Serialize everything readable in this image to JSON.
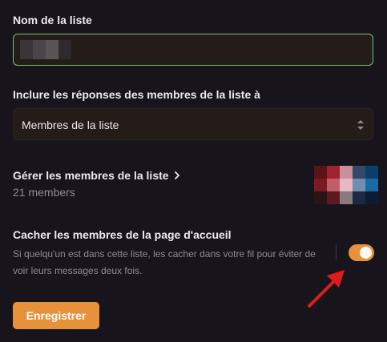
{
  "list_name": {
    "label": "Nom de la liste",
    "value_redacted": true
  },
  "include_replies": {
    "label": "Inclure les réponses des membres de la liste à",
    "selected": "Membres de la liste"
  },
  "manage_members": {
    "label": "Gérer les membres de la liste",
    "count": "21 members"
  },
  "hide_members": {
    "label": "Cacher les membres de la page d'accueil",
    "description_line1": "Si quelqu'un est dans cette liste, les cacher dans votre fil pour éviter de",
    "description_line2": "voir leurs messages deux fois.",
    "enabled": true
  },
  "save_button": {
    "label": "Enregistrer"
  },
  "colors": {
    "accent": "#e8913b",
    "focus_border": "#7fbf7a",
    "background": "#17151b",
    "field_background": "#231c19",
    "annotation_arrow": "#e01b1b"
  },
  "icons": {
    "chevron": "chevron-right-icon",
    "select_arrows": "select-arrows-icon",
    "annotation": "red-arrow-annotation"
  }
}
